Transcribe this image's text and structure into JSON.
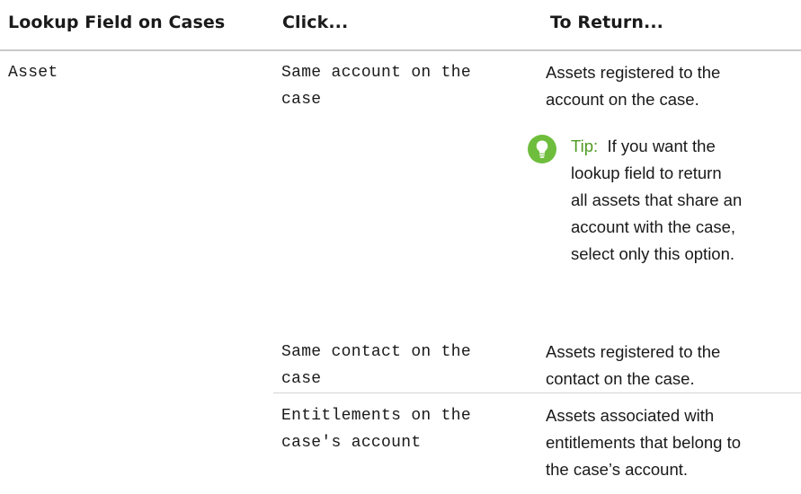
{
  "table": {
    "headers": {
      "lookup": "Lookup Field on Cases",
      "click": "Click...",
      "return": "To Return..."
    },
    "lookup_field": "Asset",
    "rows": [
      {
        "click_line1": "Same account on the",
        "click_line2": "case",
        "return_line1": "Assets registered to the",
        "return_line2": "account on the case."
      },
      {
        "click_line1": "Same contact on the",
        "click_line2": "case",
        "return_line1": "Assets registered to the",
        "return_line2": "contact on the case."
      },
      {
        "click_line1": "Entitlements on the",
        "click_line2": "case's account",
        "return_line1": "Assets associated with",
        "return_line2": "entitlements that belong to",
        "return_line3": "the case’s account."
      }
    ],
    "tip": {
      "icon": "lightbulb-icon",
      "label": "Tip:",
      "line1": "If you want the",
      "line2": "lookup field to return",
      "line3": "all assets that share an",
      "line4": "account with the case,",
      "line5": "select only this option."
    }
  },
  "colors": {
    "tip_accent": "#6ebd3c",
    "tip_label": "#4f9b23",
    "header_rule": "#c9c9c9",
    "row_rule": "#d4d4d4"
  }
}
